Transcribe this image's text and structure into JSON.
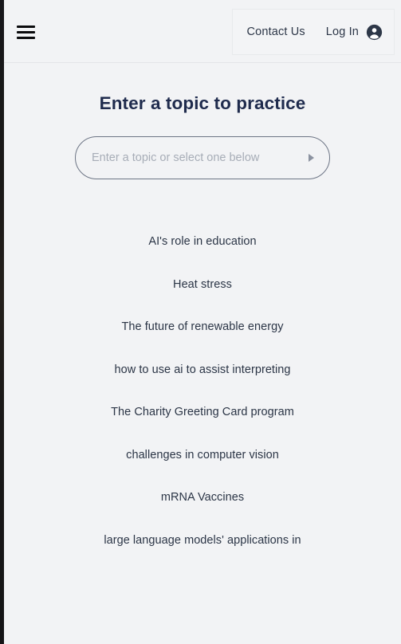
{
  "header": {
    "menu_icon": "hamburger-menu-icon",
    "nav": {
      "contact_label": "Contact Us",
      "login_label": "Log In",
      "account_icon": "account-circle-icon"
    }
  },
  "main": {
    "title": "Enter a topic to practice",
    "search": {
      "value": "",
      "placeholder": "Enter a topic or select one below",
      "dropdown_icon": "caret-right-icon"
    },
    "topics": [
      {
        "label": "AI's role in education"
      },
      {
        "label": "Heat stress"
      },
      {
        "label": "The future of renewable energy"
      },
      {
        "label": "how to use ai to assist interpreting"
      },
      {
        "label": "The Charity Greeting Card program"
      },
      {
        "label": "challenges in computer vision"
      },
      {
        "label": "mRNA Vaccines"
      },
      {
        "label": "large language models' applications in"
      }
    ]
  },
  "colors": {
    "background": "#f2f3f5",
    "title": "#1f2b4d",
    "text": "#2b3546",
    "placeholder": "#a7adb7",
    "border": "#6d7585",
    "icon_dark": "#2d3748"
  }
}
